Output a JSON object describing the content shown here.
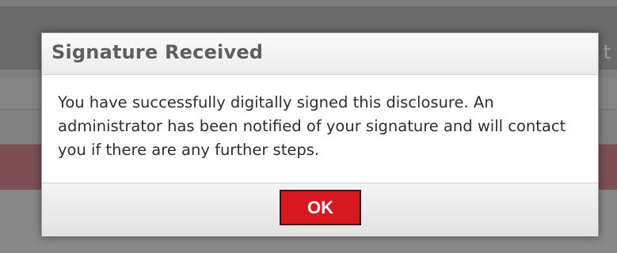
{
  "background_page": {
    "header_text": "t"
  },
  "dialog": {
    "title": "Signature Received",
    "message": "You have successfully digitally signed this disclosure. An administrator has been notified of your signature and will contact you if there are any further steps.",
    "ok_label": "OK",
    "ok_color": "#d61920"
  }
}
